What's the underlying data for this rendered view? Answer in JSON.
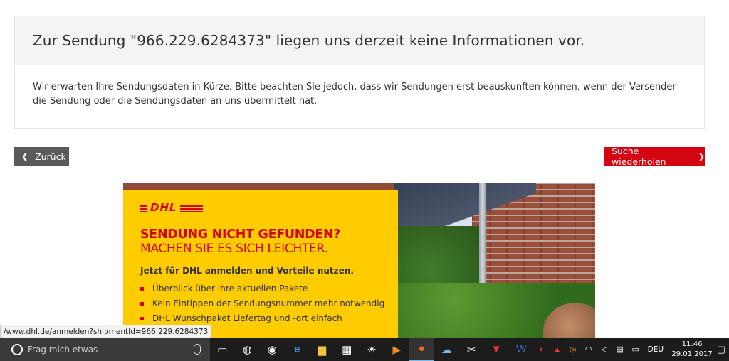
{
  "info": {
    "heading": "Zur Sendung \"966.229.6284373\" liegen uns derzeit keine Informationen vor.",
    "body": "Wir erwarten Ihre Sendungsdaten in Kürze. Bitte beachten Sie jedoch, dass wir Sendungen erst beauskunften können, wenn der Versender die Sendung oder die Sendungsdaten an uns übermittelt hat."
  },
  "buttons": {
    "back_label": "Zurück",
    "repeat_label": "Suche wiederholen"
  },
  "banner": {
    "logo_text": "DHL",
    "headline": "SENDUNG NICHT GEFUNDEN?",
    "subline": "MACHEN SIE ES SICH LEICHTER.",
    "cta": "Jetzt für DHL anmelden und Vorteile nutzen.",
    "bullets": [
      "Überblick über Ihre aktuellen Pakete",
      "Kein Eintippen der Sendungsnummer mehr notwendig",
      "DHL Wunschpaket Liefertag und -ort einfach"
    ]
  },
  "status_url": "/www.dhl.de/anmelden?shipmentId=966.229.6284373",
  "taskbar": {
    "search_placeholder": "Frag mich etwas",
    "language": "DEU",
    "time": "11:46",
    "date": "29.01.2017"
  },
  "colors": {
    "dhl_red": "#d40511",
    "dhl_yellow": "#ffcc00",
    "back_button": "#5a5a5a"
  }
}
